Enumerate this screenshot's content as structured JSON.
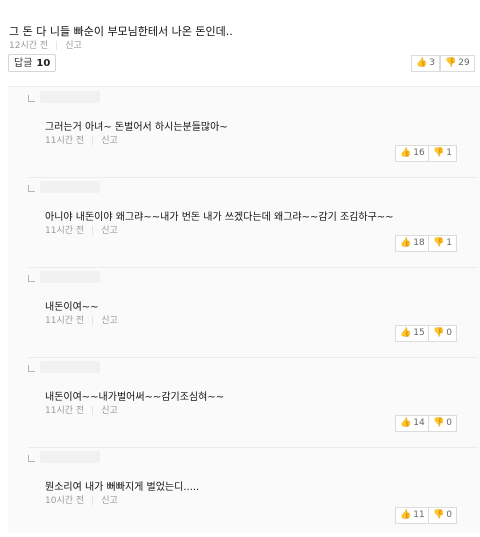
{
  "root": {
    "text": "그 돈 다 니들 빠순이 부모님한테서 나온 돈인데..",
    "time": "12시간 전",
    "report": "신고",
    "reply_label": "답글",
    "reply_count": "10",
    "up": "3",
    "down": "29"
  },
  "replies": [
    {
      "text": "그러는거 아녀~ 돈벌어서 하시는분들많아~",
      "time": "11시간 전",
      "report": "신고",
      "up": "16",
      "down": "1"
    },
    {
      "text": "아니야 내돈이야 왜그랴~~내가 번돈 내가 쓰겠다는데 왜그랴~~감기 조김하구~~",
      "time": "11시간 전",
      "report": "신고",
      "up": "18",
      "down": "1"
    },
    {
      "text": "내돈이여~~",
      "time": "11시간 전",
      "report": "신고",
      "up": "15",
      "down": "0"
    },
    {
      "text": "내돈이여~~내가벌어써~~감기조심혀~~",
      "time": "11시간 전",
      "report": "신고",
      "up": "14",
      "down": "0"
    },
    {
      "text": "뭔소리여 내가 뻐빠지게 벌었는디.....",
      "time": "10시간 전",
      "report": "신고",
      "up": "11",
      "down": "0"
    }
  ]
}
